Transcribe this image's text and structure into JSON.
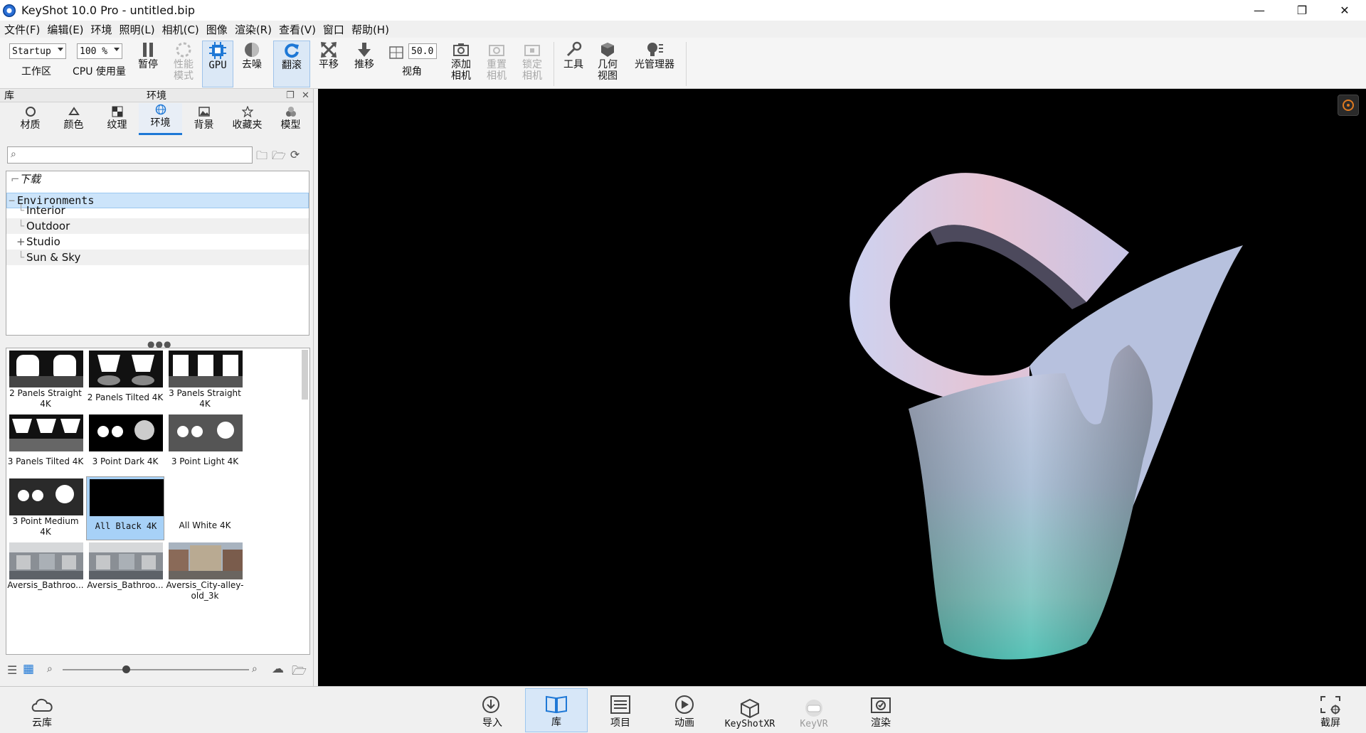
{
  "titlebar": {
    "title": "KeyShot 10.0 Pro  - untitled.bip",
    "min": "—",
    "restore": "❐",
    "close": "✕"
  },
  "menu": [
    "文件(F)",
    "编辑(E)",
    "环境",
    "照明(L)",
    "相机(C)",
    "图像",
    "渲染(R)",
    "查看(V)",
    "窗口",
    "帮助(H)"
  ],
  "toolbar": {
    "workspace_value": "Startup",
    "workspace_label": "工作区",
    "cpu_value": "100 %",
    "cpu_label": "CPU 使用量",
    "pause": "暂停",
    "perf_mode": "性能\n模式",
    "gpu": "GPU",
    "denoise": "去噪",
    "tumble": "翻滚",
    "pan": "平移",
    "dolly": "推移",
    "fov_value": "50.0",
    "fov_label": "视角",
    "add_camera": "添加\n相机",
    "reset_camera": "重置\n相机",
    "lock_camera": "锁定\n相机",
    "tools": "工具",
    "geometry_view": "几何\n视图",
    "light_manager": "光管理器"
  },
  "library": {
    "panel_title": "库",
    "section_title": "环境",
    "tabs": [
      {
        "label": "材质",
        "icon": "material-icon"
      },
      {
        "label": "颜色",
        "icon": "color-icon"
      },
      {
        "label": "纹理",
        "icon": "texture-icon"
      },
      {
        "label": "环境",
        "icon": "globe-icon"
      },
      {
        "label": "背景",
        "icon": "background-icon"
      },
      {
        "label": "收藏夹",
        "icon": "star-icon"
      },
      {
        "label": "模型",
        "icon": "model-icon"
      }
    ],
    "active_tab": "环境",
    "search_placeholder": "",
    "tree": [
      {
        "label": "下载",
        "indent": 0,
        "italic": true
      },
      {
        "label": "Environments",
        "indent": 0,
        "selected": true
      },
      {
        "label": "Interior",
        "indent": 1
      },
      {
        "label": "Outdoor",
        "indent": 1
      },
      {
        "label": "Studio",
        "indent": 1,
        "expandable": true
      },
      {
        "label": "Sun & Sky",
        "indent": 1
      }
    ],
    "thumbnails": [
      {
        "caption": "2 Panels Straight 4K",
        "kind": "panels2"
      },
      {
        "caption": "2 Panels Tilted 4K",
        "kind": "panels2tilt"
      },
      {
        "caption": "3 Panels Straight 4K",
        "kind": "panels3"
      },
      {
        "caption": "3 Panels Tilted 4K",
        "kind": "panels3tilt"
      },
      {
        "caption": "3 Point Dark 4K",
        "kind": "pointdark"
      },
      {
        "caption": "3 Point Light 4K",
        "kind": "pointlight"
      },
      {
        "caption": "3 Point Medium 4K",
        "kind": "pointmed"
      },
      {
        "caption": "All Black 4K",
        "kind": "black",
        "selected": true
      },
      {
        "caption": "All White 4K",
        "kind": "white"
      },
      {
        "caption": "Aversis_Bathroo...",
        "kind": "bath"
      },
      {
        "caption": "Aversis_Bathroo...",
        "kind": "bath"
      },
      {
        "caption": "Aversis_City-alley-old_3k",
        "kind": "city"
      }
    ]
  },
  "bottombar": {
    "cloud": "云库",
    "import": "导入",
    "library": "库",
    "project": "项目",
    "animation": "动画",
    "keyshotxr": "KeyShotXR",
    "keyvr": "KeyVR",
    "render": "渲染",
    "screenshot": "截屏"
  },
  "colors": {
    "accent": "#1e78d6",
    "selection": "#a7d1f7",
    "viewport_bg": "#000000"
  }
}
